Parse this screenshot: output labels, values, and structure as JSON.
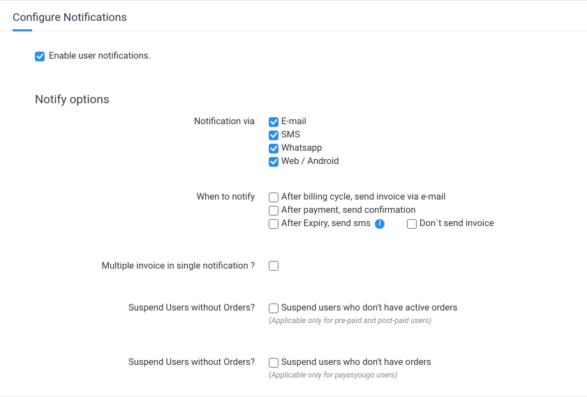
{
  "header": {
    "title": "Configure Notifications"
  },
  "enable": {
    "label": "Enable user notifications.",
    "checked": true
  },
  "section": {
    "title": "Notify options"
  },
  "rows": {
    "notification_via": {
      "label": "Notification via",
      "options": [
        {
          "label": "E-mail",
          "checked": true
        },
        {
          "label": "SMS",
          "checked": true
        },
        {
          "label": "Whatsapp",
          "checked": true
        },
        {
          "label": "Web / Android",
          "checked": true
        }
      ]
    },
    "when_to_notify": {
      "label": "When to notify",
      "options": [
        {
          "label": "After billing cycle, send invoice via e-mail",
          "checked": false
        },
        {
          "label": "After payment, send confirmation",
          "checked": false
        },
        {
          "label": "After Expiry, send sms",
          "checked": false,
          "info": true
        },
        {
          "label": "Don`t send invoice",
          "checked": false
        }
      ]
    },
    "multiple_invoice": {
      "label": "Multiple invoice in single notification ?",
      "checked": false
    },
    "suspend_active": {
      "label": "Suspend Users without Orders?",
      "option_label": "Suspend users who don't have active orders",
      "hint": "(Applicable only for pre-paid and post-paid users)",
      "checked": false
    },
    "suspend_any": {
      "label": "Suspend Users without Orders?",
      "option_label": "Suspend users who don't have orders",
      "hint": "(Applicable only for payasyougo users)",
      "checked": false
    }
  }
}
